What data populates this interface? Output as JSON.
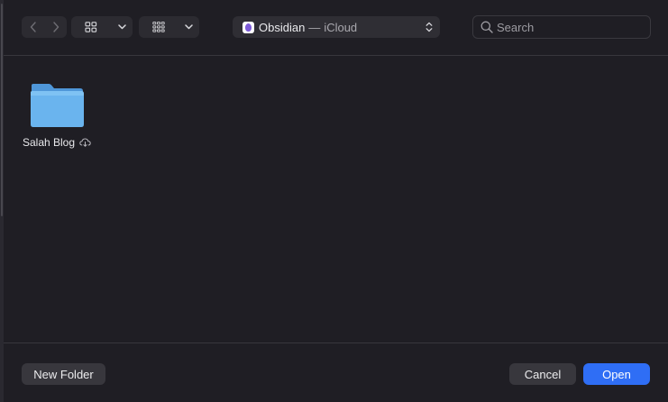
{
  "toolbar": {
    "back_icon": "chevron-left-icon",
    "forward_icon": "chevron-right-icon",
    "icon_view_icon": "grid-icon",
    "group_icon": "group-by-icon",
    "location": {
      "icon": "obsidian-icon",
      "name": "Obsidian",
      "separator": "—",
      "service": "iCloud"
    },
    "search_placeholder": "Search"
  },
  "files": [
    {
      "name": "Salah Blog",
      "type": "folder",
      "status_icon": "cloud-download-icon"
    }
  ],
  "footer": {
    "new_folder_label": "New Folder",
    "cancel_label": "Cancel",
    "open_label": "Open"
  },
  "colors": {
    "background": "#1f1e24",
    "accent": "#2f6ef5",
    "folder": "#6ab4ee"
  }
}
